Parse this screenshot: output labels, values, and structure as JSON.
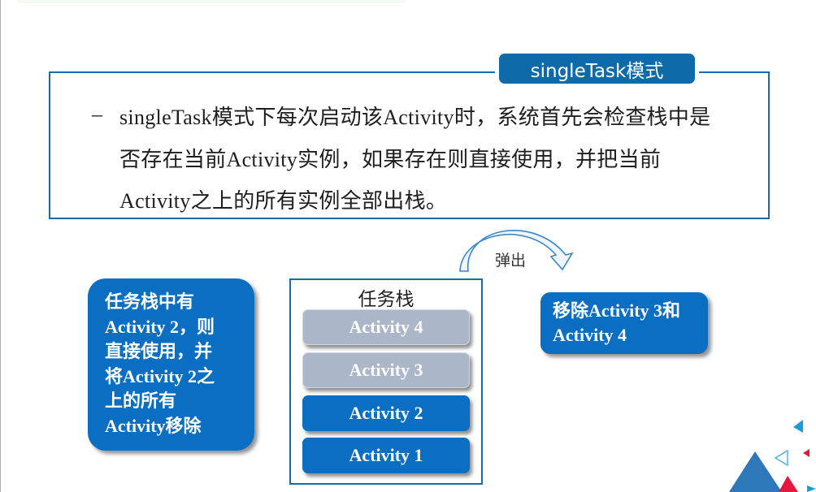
{
  "title": "singleTask模式",
  "description": {
    "bullet": "–",
    "lines": [
      "singleTask模式下每次启动该Activity时，系统首先会检查栈中是",
      "否存在当前Activity实例，如果存在则直接使用，并把当前",
      "Activity之上的所有实例全部出栈。"
    ]
  },
  "left_card": {
    "lines": [
      "任务栈中有",
      "Activity 2，则",
      "直接使用，并",
      "将Activity 2之",
      "上的所有",
      "Activity移除"
    ]
  },
  "stack": {
    "title": "任务栈",
    "items": [
      {
        "label": "Activity 4",
        "state": "popped"
      },
      {
        "label": "Activity 3",
        "state": "popped"
      },
      {
        "label": "Activity 2",
        "state": "kept"
      },
      {
        "label": "Activity 1",
        "state": "kept"
      }
    ]
  },
  "pop_arrow": {
    "label": "弹出",
    "icon": "curved-arrow-icon"
  },
  "right_card": {
    "lines": [
      "移除Activity 3和",
      "Activity 4"
    ]
  },
  "colors": {
    "primary_blue": "#0a6fc2",
    "border_blue": "#1c6aa6",
    "popped_gray": "#abb7c8",
    "deco_red": "#e5173f",
    "deco_light_blue": "#1f9ad9"
  }
}
